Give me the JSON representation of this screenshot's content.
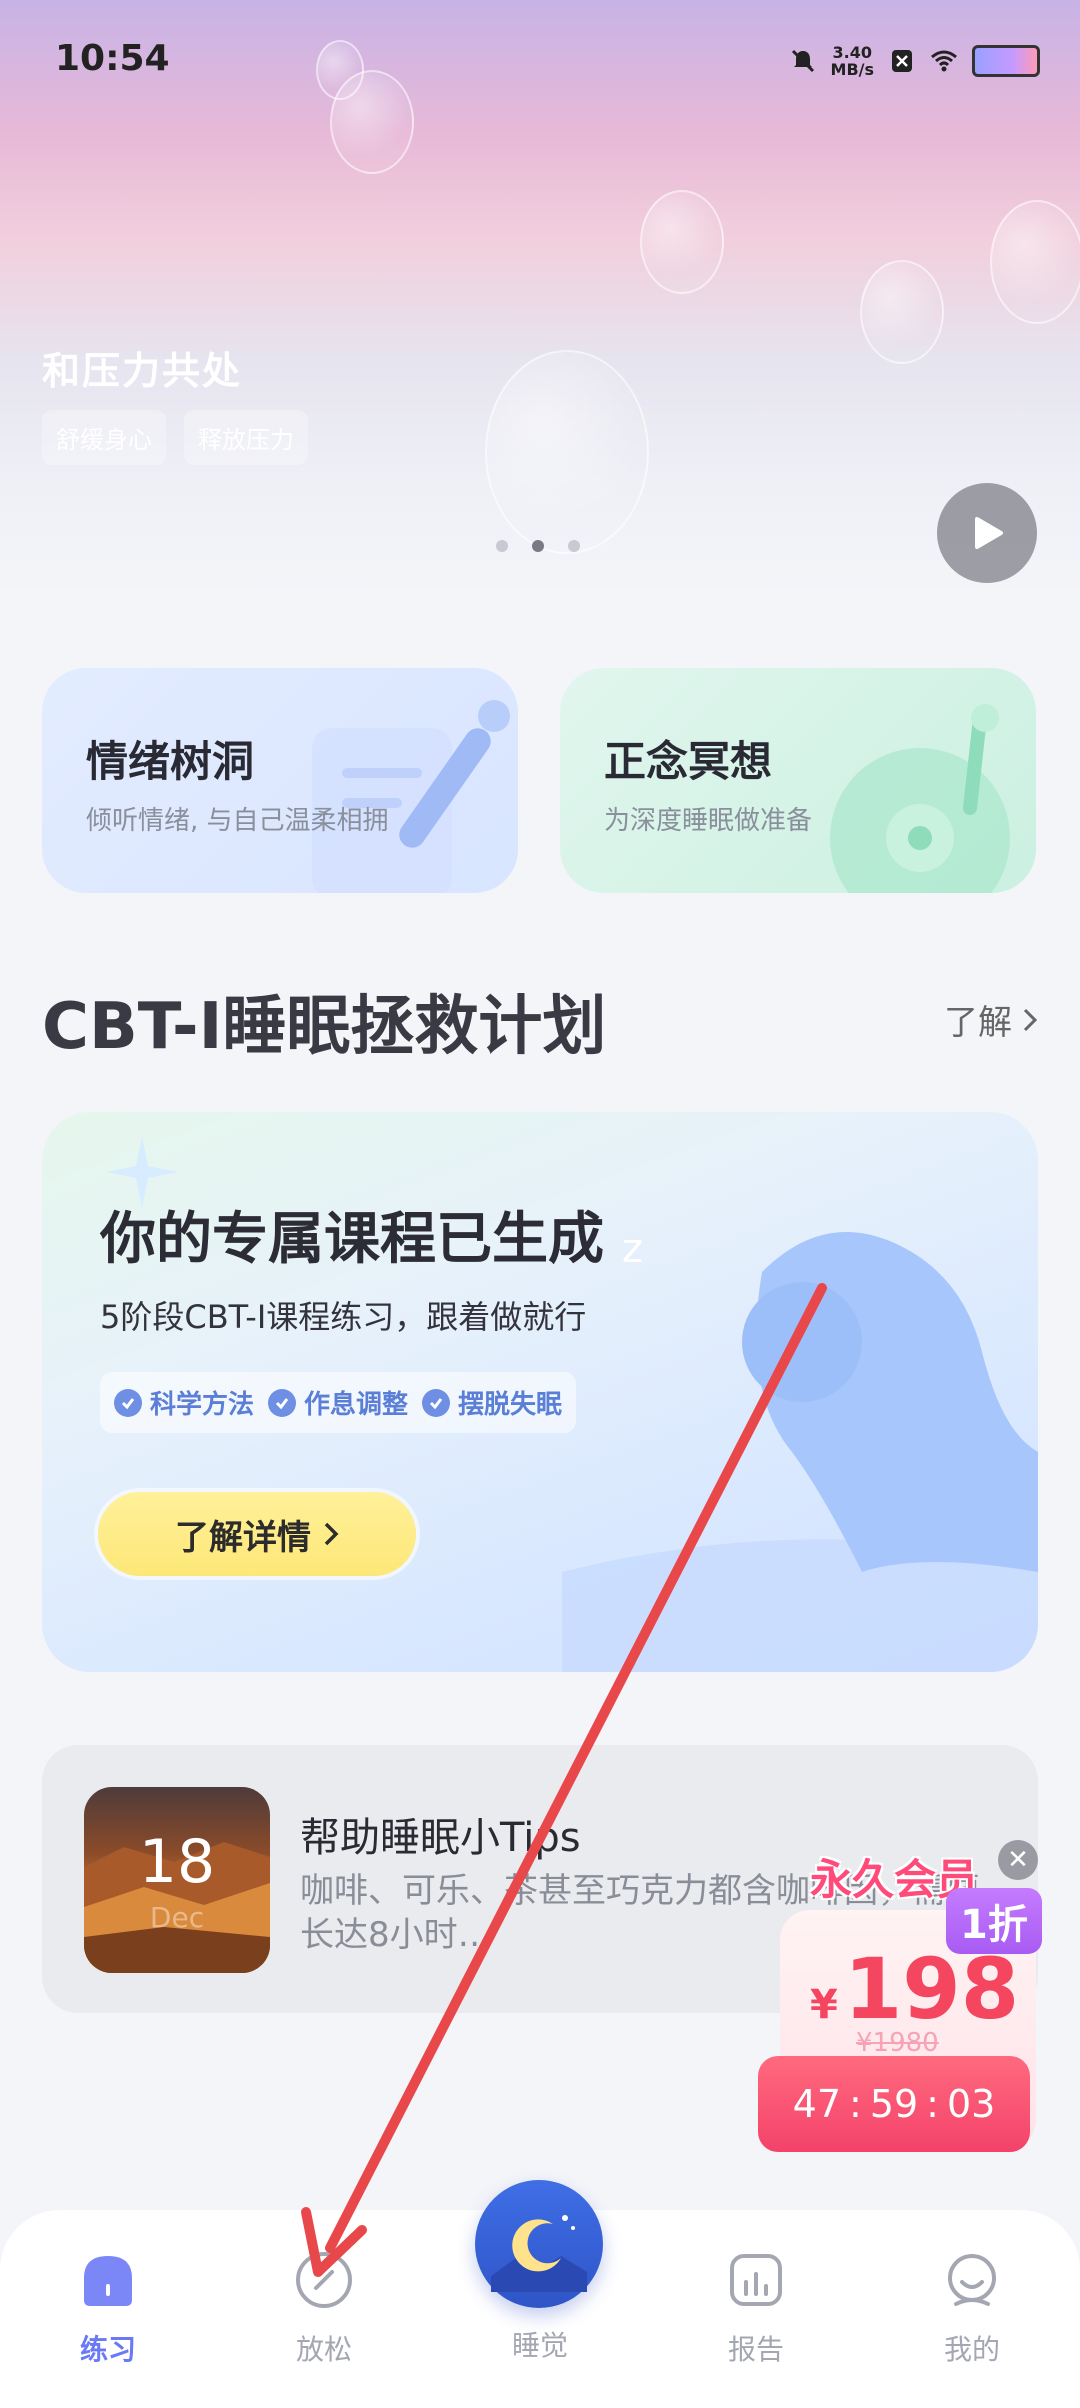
{
  "status": {
    "time": "10:54",
    "speed_value": "3.40",
    "speed_unit": "MB/s"
  },
  "hero": {
    "title": "和压力共处",
    "tags": [
      "舒缓身心",
      "释放压力"
    ],
    "carousel_pages": 3,
    "carousel_active": 2
  },
  "features": [
    {
      "title": "情绪树洞",
      "subtitle": "倾听情绪, 与自己温柔相拥"
    },
    {
      "title": "正念冥想",
      "subtitle": "为深度睡眠做准备"
    }
  ],
  "section": {
    "title": "CBT-I睡眠拯救计划",
    "link": "了解"
  },
  "course": {
    "title": "你的专属课程已生成",
    "subtitle": "5阶段CBT-I课程练习，跟着做就行",
    "tags": [
      "科学方法",
      "作息调整",
      "摆脱失眠"
    ],
    "button": "了解详情"
  },
  "tips": {
    "day": "18",
    "month": "Dec",
    "title": "帮助睡眠小Tips",
    "text": "咖啡、可乐、茶甚至巧克力都含咖啡因，需要长达8小时…"
  },
  "promo": {
    "title": "永久会员",
    "discount": "1折",
    "currency": "¥",
    "price": "198",
    "original": "¥1980",
    "timer": [
      "47",
      "59",
      "03"
    ]
  },
  "nav": [
    {
      "label": "练习",
      "active": true
    },
    {
      "label": "放松"
    },
    {
      "label": "睡觉"
    },
    {
      "label": "报告"
    },
    {
      "label": "我的"
    }
  ],
  "colors": {
    "accent": "#6a79f5",
    "promo_red": "#f4426a",
    "arrow": "#e9484b"
  }
}
